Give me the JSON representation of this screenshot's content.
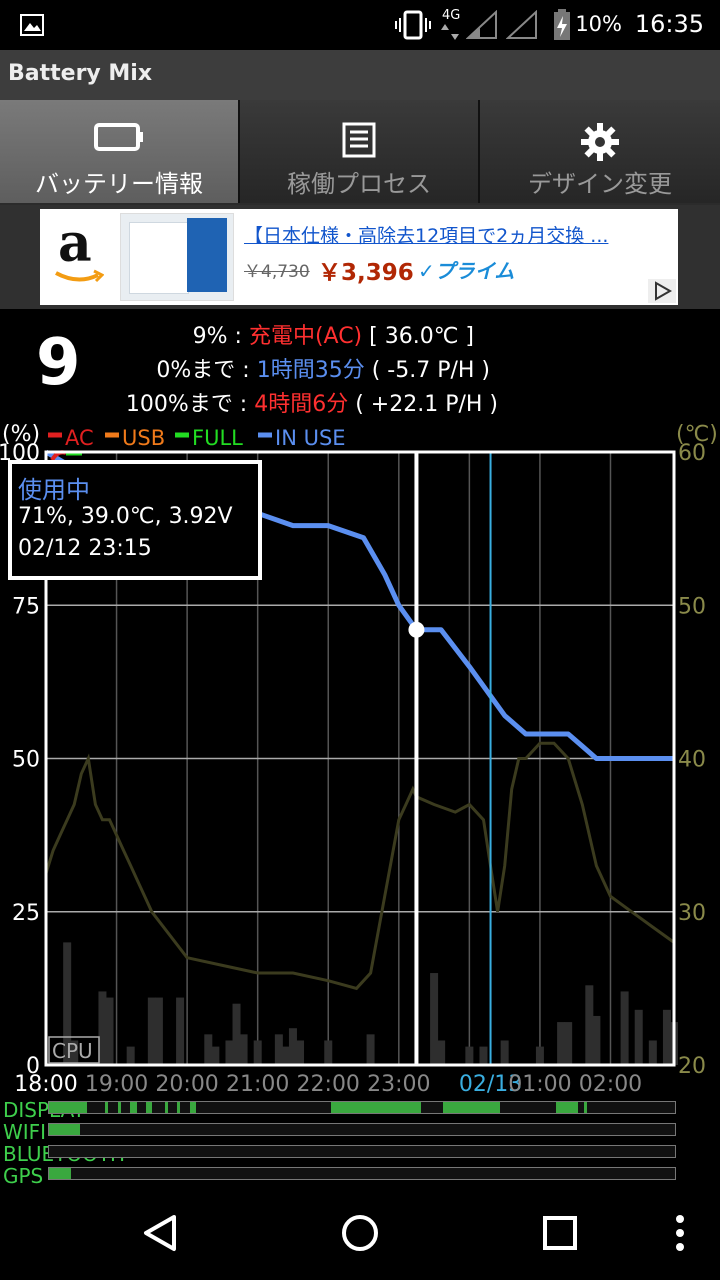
{
  "status_bar": {
    "battery_percent": "10%",
    "time": "16:35",
    "network": "4G"
  },
  "app_title": "Battery Mix",
  "tabs": [
    {
      "label": "バッテリー情報",
      "icon": "battery-icon",
      "active": true
    },
    {
      "label": "稼働プロセス",
      "icon": "list-icon",
      "active": false
    },
    {
      "label": "デザイン変更",
      "icon": "gear-icon",
      "active": false
    }
  ],
  "ad": {
    "title": "【日本仕様・高除去12項目で2ヵ月交換 ...",
    "old_price": "￥4,730",
    "price": "￥3,396",
    "prime": "✓プライム",
    "logo": "a"
  },
  "battery": {
    "level": "9",
    "line1_label": "9% : ",
    "line1_value": "充電中(AC)",
    "line1_extra": " [ 36.0℃ ]",
    "line2_label": "0%まで : ",
    "line2_value": "1時間35分",
    "line2_extra": " ( -5.7 P/H )",
    "line3_label": "100%まで : ",
    "line3_value": "4時間6分",
    "line3_extra": " ( +22.1 P/H )"
  },
  "chart_data": {
    "type": "line",
    "ylabel_left": "(%)",
    "ylabel_right": "(℃)",
    "legend": [
      {
        "name": "AC",
        "color": "#e02020"
      },
      {
        "name": "USB",
        "color": "#f07a1a"
      },
      {
        "name": "FULL",
        "color": "#22dd22"
      },
      {
        "name": "IN USE",
        "color": "#5b8ff0"
      }
    ],
    "left_ticks": [
      "100",
      "75",
      "50",
      "25",
      "0"
    ],
    "right_ticks": [
      "60",
      "50",
      "40",
      "30",
      "20"
    ],
    "x_ticks": [
      "18:00",
      "19:00",
      "20:00",
      "21:00",
      "22:00",
      "23:00",
      "02/13",
      "01:00",
      "02:00"
    ],
    "cpu_label": "CPU",
    "tooltip": {
      "title": "使用中",
      "line1": "71%, 39.0℃, 3.92V",
      "line2": "02/12 23:15"
    },
    "series": [
      {
        "name": "IN USE",
        "values": [
          [
            18.0,
            100
          ],
          [
            18.3,
            98
          ],
          [
            18.6,
            96
          ],
          [
            19.0,
            94
          ],
          [
            19.5,
            92
          ],
          [
            20.0,
            91
          ],
          [
            20.5,
            90
          ],
          [
            21.0,
            90
          ],
          [
            21.5,
            88
          ],
          [
            22.0,
            88
          ],
          [
            22.5,
            86
          ],
          [
            22.8,
            80
          ],
          [
            23.0,
            75
          ],
          [
            23.25,
            71
          ],
          [
            23.6,
            71
          ],
          [
            24.0,
            65
          ],
          [
            24.5,
            57
          ],
          [
            24.8,
            54
          ],
          [
            25.0,
            54
          ],
          [
            25.4,
            54
          ],
          [
            25.6,
            52
          ],
          [
            25.8,
            50
          ],
          [
            26.3,
            50
          ],
          [
            26.9,
            50
          ]
        ]
      },
      {
        "name": "Temperature",
        "values": [
          [
            18.0,
            32.5
          ],
          [
            18.1,
            34
          ],
          [
            18.2,
            35
          ],
          [
            18.3,
            36
          ],
          [
            18.4,
            37
          ],
          [
            18.5,
            39
          ],
          [
            18.6,
            40
          ],
          [
            18.7,
            37
          ],
          [
            18.8,
            36
          ],
          [
            18.9,
            36
          ],
          [
            19.0,
            35
          ],
          [
            19.1,
            34
          ],
          [
            19.2,
            33
          ],
          [
            19.3,
            32
          ],
          [
            19.5,
            30
          ],
          [
            20.0,
            27
          ],
          [
            20.5,
            26.5
          ],
          [
            21.0,
            26
          ],
          [
            21.5,
            26
          ],
          [
            22.0,
            25.5
          ],
          [
            22.4,
            25
          ],
          [
            22.6,
            26
          ],
          [
            22.8,
            31
          ],
          [
            23.0,
            36
          ],
          [
            23.1,
            37
          ],
          [
            23.2,
            38
          ],
          [
            23.25,
            37.5
          ],
          [
            23.5,
            37
          ],
          [
            23.8,
            36.5
          ],
          [
            24.0,
            37
          ],
          [
            24.2,
            36
          ],
          [
            24.3,
            33
          ],
          [
            24.4,
            30
          ],
          [
            24.5,
            33
          ],
          [
            24.6,
            38
          ],
          [
            24.7,
            40
          ],
          [
            24.8,
            40
          ],
          [
            25.0,
            41
          ],
          [
            25.2,
            41
          ],
          [
            25.4,
            40
          ],
          [
            25.6,
            37
          ],
          [
            25.8,
            33
          ],
          [
            26.0,
            31
          ],
          [
            26.3,
            30
          ],
          [
            26.6,
            29
          ],
          [
            26.9,
            28
          ]
        ]
      }
    ],
    "cpu_bars": [
      [
        18.3,
        20
      ],
      [
        18.4,
        4
      ],
      [
        18.8,
        12
      ],
      [
        18.9,
        11
      ],
      [
        19.2,
        3
      ],
      [
        19.5,
        11
      ],
      [
        19.6,
        11
      ],
      [
        19.9,
        11
      ],
      [
        20.3,
        5
      ],
      [
        20.4,
        3
      ],
      [
        20.6,
        4
      ],
      [
        20.7,
        10
      ],
      [
        20.8,
        5
      ],
      [
        21.0,
        4
      ],
      [
        21.3,
        5
      ],
      [
        21.4,
        3
      ],
      [
        21.5,
        6
      ],
      [
        21.6,
        4
      ],
      [
        22.0,
        4
      ],
      [
        22.6,
        5
      ],
      [
        23.5,
        15
      ],
      [
        23.6,
        4
      ],
      [
        24.0,
        3
      ],
      [
        24.2,
        3
      ],
      [
        24.5,
        4
      ],
      [
        25.0,
        3
      ],
      [
        25.3,
        7
      ],
      [
        25.4,
        7
      ],
      [
        25.7,
        13
      ],
      [
        25.8,
        8
      ],
      [
        26.2,
        12
      ],
      [
        26.4,
        9
      ],
      [
        26.6,
        4
      ],
      [
        26.8,
        9
      ],
      [
        26.9,
        7
      ]
    ],
    "now_x": 23.25,
    "midnight_x": 24.3
  },
  "timeline": {
    "rows": [
      {
        "label": "DISPLAY",
        "segments": [
          [
            0,
            0.06
          ],
          [
            0.09,
            0.095
          ],
          [
            0.11,
            0.115
          ],
          [
            0.13,
            0.14
          ],
          [
            0.155,
            0.165
          ],
          [
            0.185,
            0.19
          ],
          [
            0.205,
            0.21
          ],
          [
            0.225,
            0.235
          ],
          [
            0.45,
            0.595
          ],
          [
            0.63,
            0.72
          ],
          [
            0.81,
            0.845
          ],
          [
            0.855,
            0.86
          ]
        ]
      },
      {
        "label": "WIFI",
        "segments": [
          [
            0,
            0.05
          ]
        ]
      },
      {
        "label": "BLUETOOTH",
        "segments": []
      },
      {
        "label": "GPS",
        "segments": [
          [
            0,
            0.035
          ]
        ]
      }
    ]
  }
}
